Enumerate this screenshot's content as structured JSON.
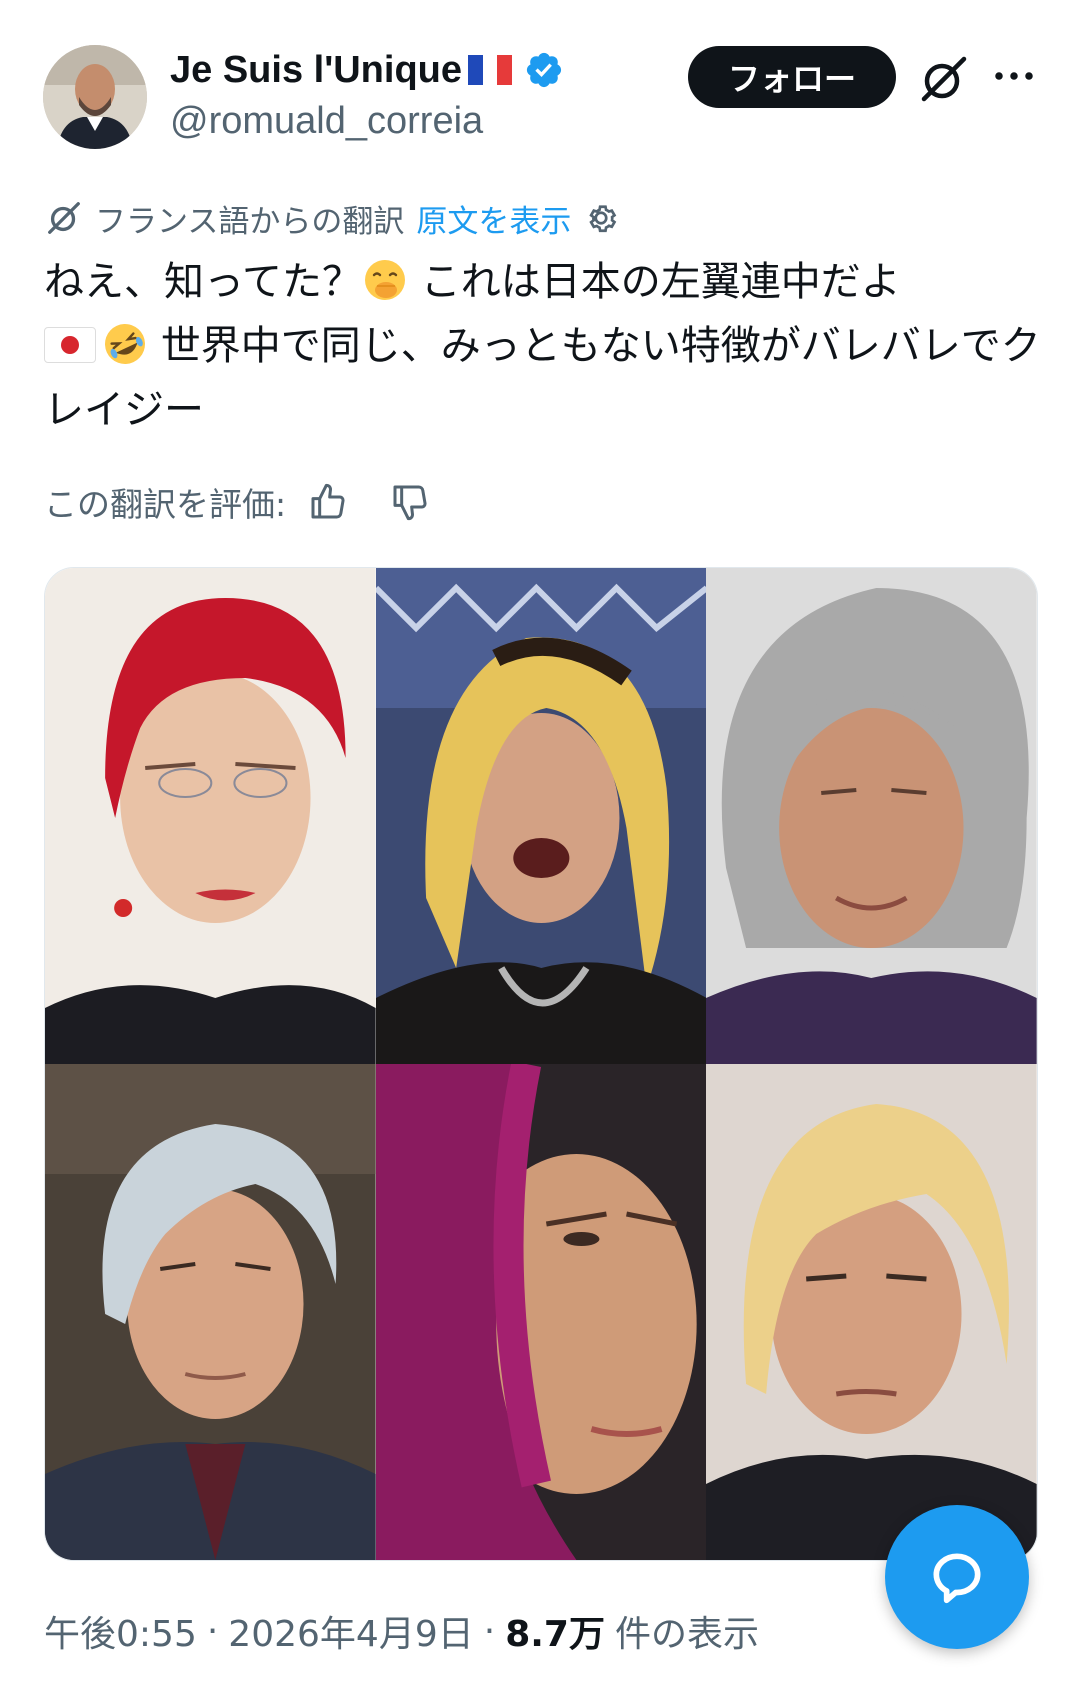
{
  "author": {
    "display_name": "Je Suis l'Unique",
    "handle": "@romuald_correia"
  },
  "actions": {
    "follow_label": "フォロー"
  },
  "translation": {
    "notice": "フランス語からの翻訳",
    "show_original": "原文を表示",
    "rate_label": "この翻訳を評価:"
  },
  "tweet": {
    "part1": "ねえ、知ってた？",
    "part2": " これは日本の左翼連中だよ ",
    "part3": " 世界中で同じ、みっともない特徴がバレバレでクレイジー"
  },
  "meta": {
    "time": "午後0:55",
    "date": "2026年4月9日",
    "views_count": "8.7万",
    "views_label": "件の表示",
    "sep": "·"
  },
  "colors": {
    "accent": "#1d9bf0",
    "text": "#0f1419",
    "secondary": "#536471"
  },
  "icons": {
    "verified": "verified-badge-icon",
    "grok": "grok-icon",
    "more": "more-icon",
    "translate": "translate-icon",
    "settings": "settings-gear-icon",
    "thumbs_up": "thumbs-up-icon",
    "thumbs_down": "thumbs-down-icon",
    "reply_fab": "reply-bubble-icon"
  },
  "media": {
    "tile_count": 6
  }
}
